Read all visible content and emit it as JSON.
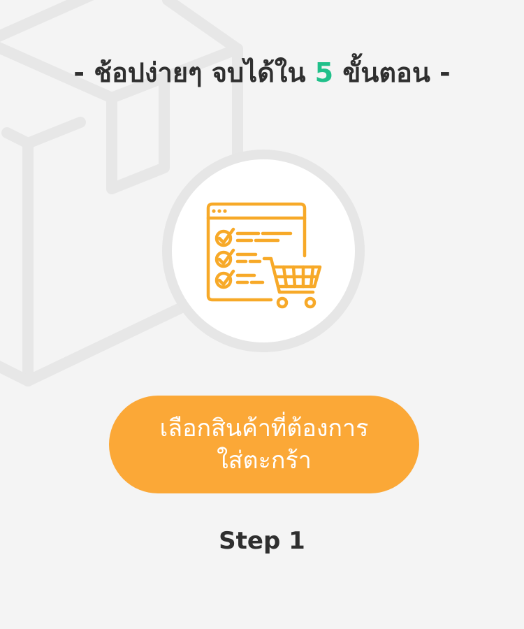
{
  "header": {
    "prefix": "- ช้อปง่ายๆ จบได้ใน",
    "step_count": "5",
    "suffix": "ขั้นตอน -"
  },
  "icon": {
    "name": "checklist-cart-icon"
  },
  "cta": {
    "line1": "เลือกสินค้าที่ต้องการ",
    "line2": "ใส่ตะกร้า"
  },
  "step": {
    "label": "Step 1"
  },
  "colors": {
    "background": "#f4f4f4",
    "accent_green": "#20c08a",
    "accent_orange": "#fba837",
    "icon_orange": "#f7a928",
    "text_dark": "#2f2f2f"
  }
}
